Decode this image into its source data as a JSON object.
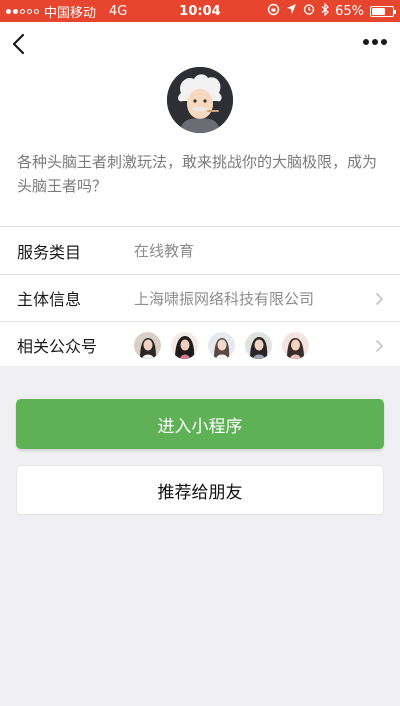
{
  "status_bar": {
    "carrier": "中国移动",
    "network": "4G",
    "time": "10:04",
    "battery_percent": "65%",
    "battery_level": 0.65
  },
  "nav": {
    "back_icon": "chevron-left-icon",
    "more_icon": "more-dots-icon"
  },
  "profile": {
    "description": "各种头脑王者刺激玩法，敢来挑战你的大脑极限，成为头脑王者吗？"
  },
  "info": {
    "service_category_label": "服务类目",
    "service_category_value": "在线教育",
    "entity_label": "主体信息",
    "entity_value": "上海啸振网络科技有限公司",
    "related_accounts_label": "相关公众号"
  },
  "actions": {
    "enter_label": "进入小程序",
    "share_label": "推荐给朋友"
  },
  "colors": {
    "status_bar": "#e8452e",
    "primary_button": "#5eb255",
    "page_background": "#efeff4"
  }
}
